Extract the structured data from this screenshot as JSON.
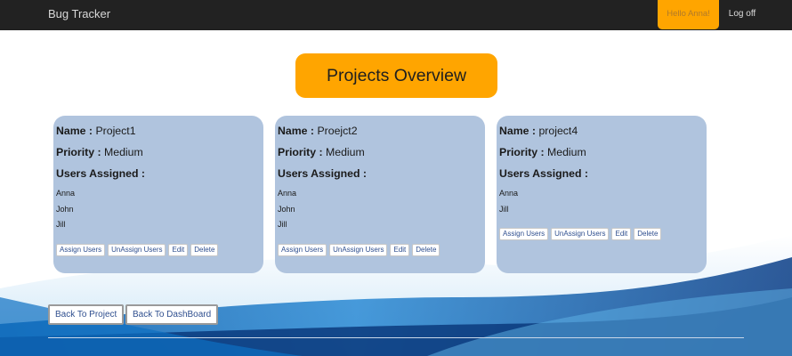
{
  "navbar": {
    "brand": "Bug Tracker",
    "greeting": "Hello Anna!",
    "logoff": "Log off"
  },
  "page": {
    "title": "Projects Overview"
  },
  "labels": {
    "name": "Name :",
    "priority": "Priority :",
    "users_assigned": "Users Assigned :"
  },
  "projects": [
    {
      "name": "Project1",
      "priority": "Medium",
      "users": [
        "Anna",
        "John",
        "Jill"
      ]
    },
    {
      "name": "Proejct2",
      "priority": "Medium",
      "users": [
        "Anna",
        "John",
        "Jill"
      ]
    },
    {
      "name": "project4",
      "priority": "Medium",
      "users": [
        "Anna",
        "Jill"
      ]
    }
  ],
  "card_actions": {
    "assign": "Assign Users",
    "unassign": "UnAssign Users",
    "edit": "Edit",
    "delete": "Delete"
  },
  "footer_buttons": {
    "back_to_project": "Back To Project",
    "back_to_dashboard": "Back To DashBoard"
  },
  "colors": {
    "navbar": "#222222",
    "accent": "#ffa500",
    "card": "#b0c4de"
  }
}
